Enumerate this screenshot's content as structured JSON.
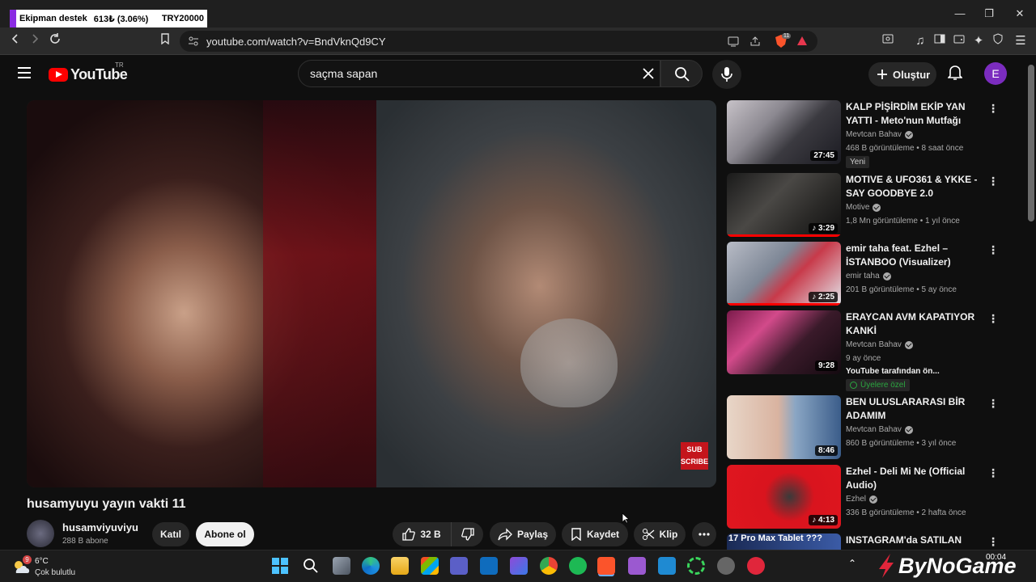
{
  "donation": {
    "t1": "Ekipman destek",
    "t2": "613₺ (3.06%)",
    "t3": "TRY20000",
    "progress_percent": 3.06
  },
  "browser": {
    "url": "youtube.com/watch?v=BndVknQd9CY",
    "shield_count": "11"
  },
  "header": {
    "logo_word": "YouTube",
    "region": "TR",
    "search_value": "saçma sapan",
    "create_label": "Oluştur",
    "avatar_letter": "E"
  },
  "video": {
    "subscribe_overlay": "SUB SCRIBE",
    "title": "husamyuyu yayın vakti 11"
  },
  "channel": {
    "name": "husamviyuviyu",
    "subs": "288 B abone",
    "join_label": "Katıl",
    "subscribe_label": "Abone ol"
  },
  "actions": {
    "likes": "32 B",
    "share": "Paylaş",
    "save": "Kaydet",
    "clip": "Klip"
  },
  "recommendations": [
    {
      "title": "KALP PİŞİRDİM EKİP YAN YATTI - Meto'nun Mutfağı",
      "channel": "Mevtcan Bahav",
      "meta": "468 B görüntüleme • 8 saat önce",
      "duration": "27:45",
      "badge": "Yeni"
    },
    {
      "title": "MOTIVE & UFO361 & YKKE - SAY GOODBYE 2.0",
      "channel": "Motive",
      "meta": "1,8 Mn görüntüleme • 1 yıl önce",
      "duration": "3:29"
    },
    {
      "title": "emir taha feat. Ezhel – İSTANBOO (Visualizer)",
      "channel": "emir taha",
      "meta": "201 B görüntüleme • 5 ay önce",
      "duration": "2:25"
    },
    {
      "title": "ERAYCAN AVM KAPATIYOR KANKİ",
      "channel": "Mevtcan Bahav",
      "meta": "9 ay önce",
      "note": "YouTube tarafından ön...",
      "members": "Üyelere özel",
      "duration": "9:28"
    },
    {
      "title": "BEN ULUSLARARASI BİR ADAMIM",
      "channel": "Mevtcan Bahav",
      "meta": "860 B görüntüleme • 3 yıl önce",
      "duration": "8:46"
    },
    {
      "title": "Ezhel - Deli Mi Ne (Official Audio)",
      "channel": "Ezhel",
      "meta": "336 B görüntüleme • 2 hafta önce",
      "duration": "4:13"
    },
    {
      "title": "INSTAGRAM'da SATILAN",
      "thumb_text": "17 Pro Max Tablet ???"
    }
  ],
  "taskbar": {
    "temp": "6°C",
    "condition": "Çok bulutlu",
    "weather_badge": "9",
    "watermark": "ByNoGame",
    "clock": "00:04"
  },
  "colors": {
    "yt_red": "#ff0000",
    "accent_purple": "#7b2cbf",
    "subscribe_red": "#c4151c"
  }
}
